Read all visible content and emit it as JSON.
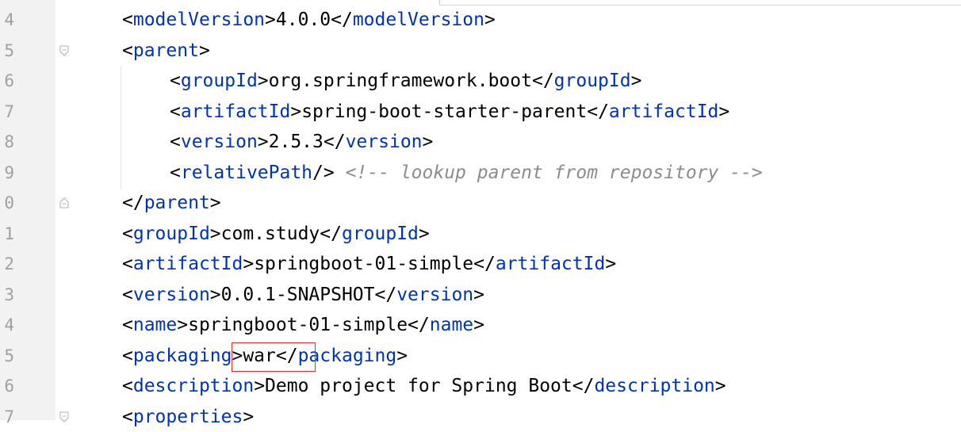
{
  "editor": {
    "lines": [
      {
        "number": "4",
        "pre": "<",
        "tag_open": "modelVersion",
        "mid": ">4.0.0</",
        "tag_close": "modelVersion",
        "post": ">"
      },
      {
        "number": "5",
        "pre": "<",
        "tag_open": "parent",
        "post": ">"
      },
      {
        "number": "6",
        "pre": "<",
        "tag_open": "groupId",
        "mid": ">org.springframework.boot</",
        "tag_close": "groupId",
        "post": ">"
      },
      {
        "number": "7",
        "pre": "<",
        "tag_open": "artifactId",
        "mid": ">spring-boot-starter-parent</",
        "tag_close": "artifactId",
        "post": ">"
      },
      {
        "number": "8",
        "pre": "<",
        "tag_open": "version",
        "mid": ">2.5.3</",
        "tag_close": "version",
        "post": ">"
      },
      {
        "number": "9",
        "pre": "<",
        "tag_open": "relativePath",
        "post": "/> ",
        "comment": "<!-- lookup parent from repository -->"
      },
      {
        "number": "0",
        "pre": "</",
        "tag_open": "parent",
        "post": ">"
      },
      {
        "number": "1",
        "pre": "<",
        "tag_open": "groupId",
        "mid": ">com.study</",
        "tag_close": "groupId",
        "post": ">"
      },
      {
        "number": "2",
        "pre": "<",
        "tag_open": "artifactId",
        "mid": ">springboot-01-simple</",
        "tag_close": "artifactId",
        "post": ">"
      },
      {
        "number": "3",
        "pre": "<",
        "tag_open": "version",
        "mid": ">0.0.1-SNAPSHOT</",
        "tag_close": "version",
        "post": ">"
      },
      {
        "number": "4",
        "pre": "<",
        "tag_open": "name",
        "mid": ">springboot-01-simple</",
        "tag_close": "name",
        "post": ">"
      },
      {
        "number": "5",
        "pre": "<",
        "tag_open": "packaging",
        "mid": ">war</",
        "tag_close": "packaging",
        "post": ">"
      },
      {
        "number": "6",
        "pre": "<",
        "tag_open": "description",
        "mid": ">Demo project for Spring Boot</",
        "tag_close": "description",
        "post": ">"
      },
      {
        "number": "7",
        "pre": "<",
        "tag_open": "properties",
        "post": ">"
      }
    ]
  },
  "colors": {
    "tag": "#0033b3",
    "text": "#000000",
    "comment": "#8c8c8c",
    "highlight": "#e03030"
  }
}
